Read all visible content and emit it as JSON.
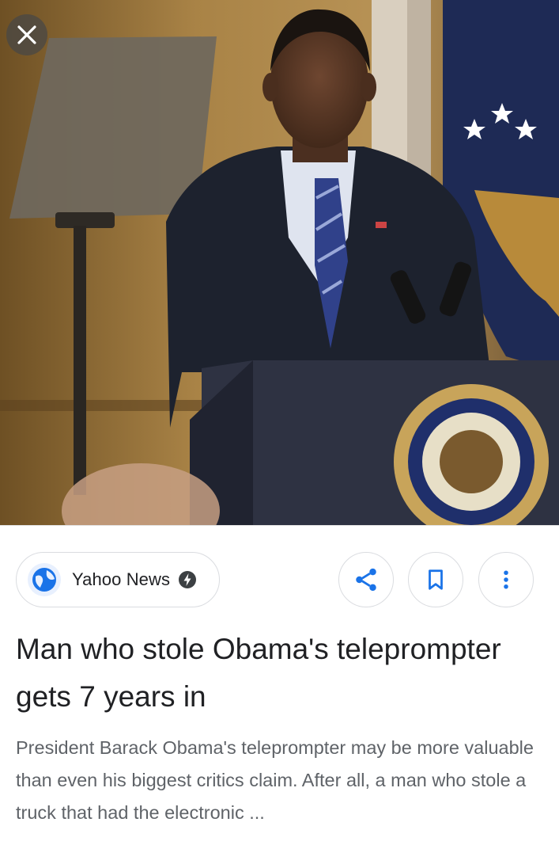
{
  "image": {
    "alt": "Barack Obama standing at a podium next to a teleprompter",
    "icon": "news-photo"
  },
  "close": {
    "icon": "close-icon"
  },
  "source": {
    "name": "Yahoo News",
    "icon": "globe-icon",
    "badge_icon": "amp-bolt-icon"
  },
  "actions": [
    {
      "name": "share",
      "icon": "share-icon"
    },
    {
      "name": "save",
      "icon": "bookmark-icon"
    },
    {
      "name": "more",
      "icon": "more-vert-icon"
    }
  ],
  "article": {
    "headline": "Man who stole Obama's teleprompter gets 7 years in",
    "snippet": "President Barack Obama's teleprompter may be more valuable than even his biggest critics claim. After all, a man who stole a truck that had the electronic ..."
  },
  "colors": {
    "accent": "#1a73e8",
    "headline": "#202124",
    "snippet": "#5f6368",
    "border": "#dadce0"
  }
}
